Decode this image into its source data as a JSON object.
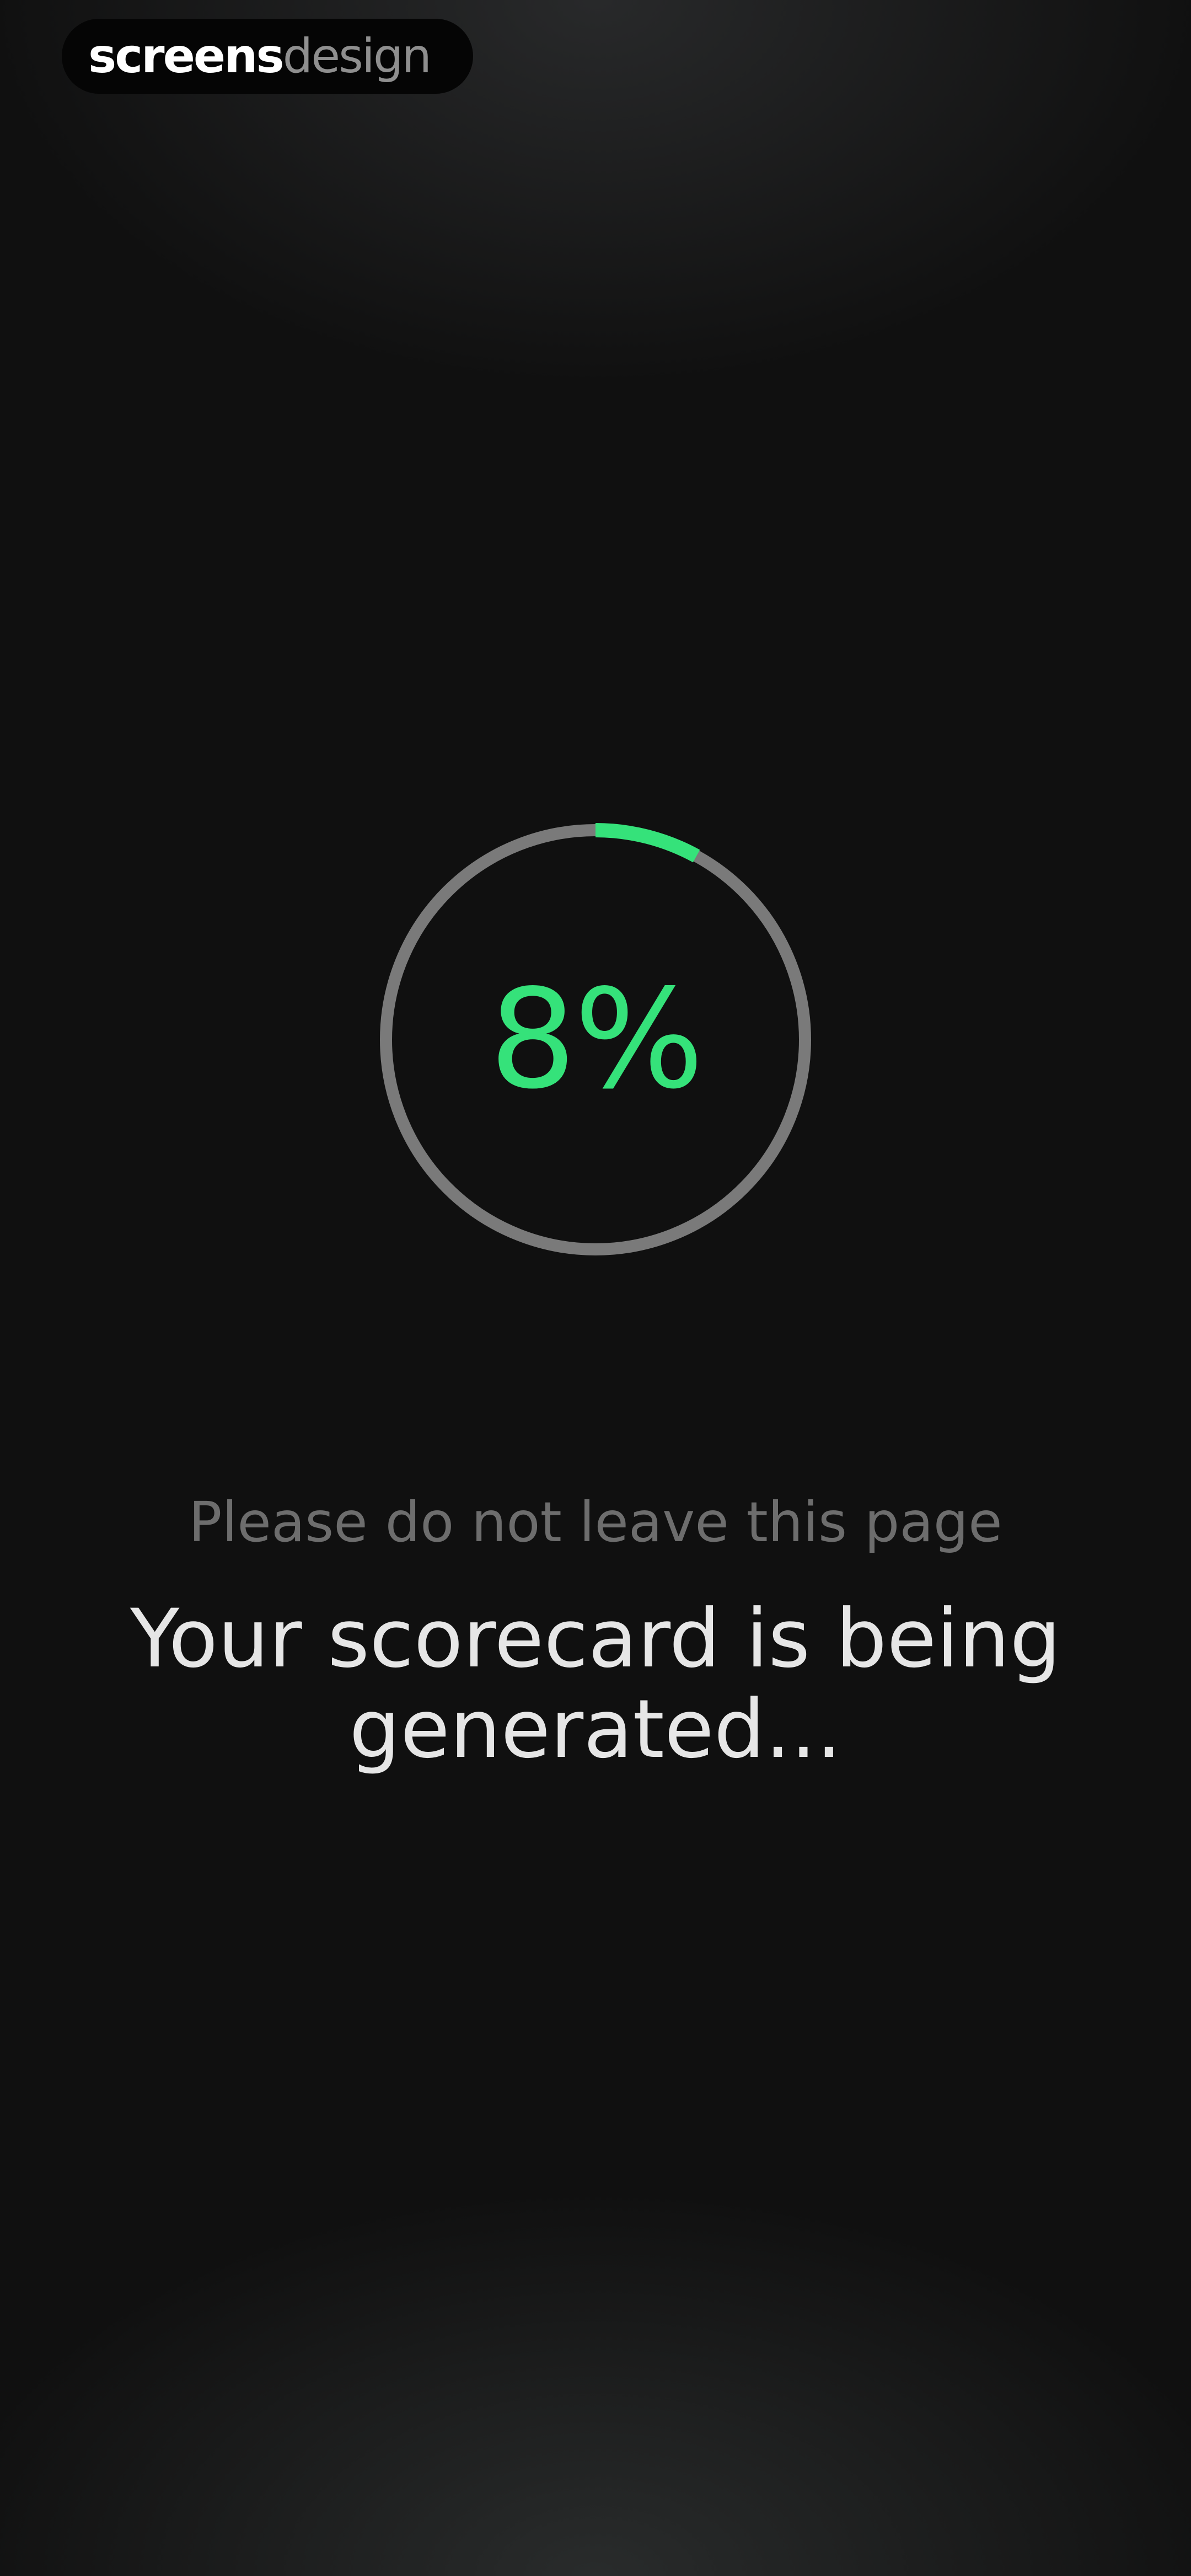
{
  "brand": {
    "strong_text": "screens",
    "light_text": "design"
  },
  "progress": {
    "value": 0.08,
    "label": "8%",
    "ring_color": "#35e27a",
    "track_color": "#7a7a7a"
  },
  "message": {
    "note": "Please do not leave this page",
    "headline": "Your scorecard is being generated..."
  }
}
